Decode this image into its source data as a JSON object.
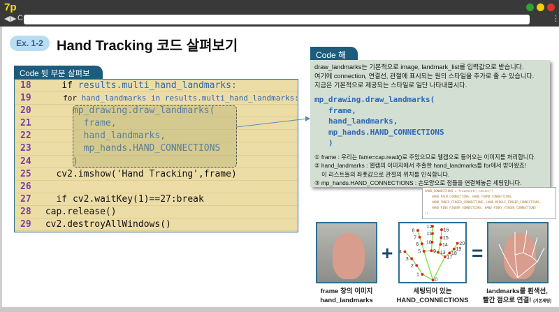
{
  "browser": {
    "logo": "7p",
    "back": "◀",
    "forward": "▶",
    "reload": "C",
    "menu": "⋮"
  },
  "header": {
    "badge": "Ex. 1-2",
    "title": "Hand Tracking 코드 살펴보기"
  },
  "code_section": {
    "tab": "Code 뒷 부분 살펴보기",
    "lines": [
      {
        "n": "18",
        "indent": "    ",
        "kw": "if ",
        "rest": "results.multi_hand_landmarks:"
      },
      {
        "n": "19",
        "indent": "     ",
        "kw": "for ",
        "rest": "hand_landmarks in results.multi_hand_landmarks:"
      },
      {
        "n": "20",
        "indent": "      ",
        "kw": "",
        "rest": "mp_drawing.draw_landmarks("
      },
      {
        "n": "21",
        "indent": "        ",
        "kw": "",
        "rest": "frame,"
      },
      {
        "n": "22",
        "indent": "        ",
        "kw": "",
        "rest": "hand_landmarks,"
      },
      {
        "n": "23",
        "indent": "        ",
        "kw": "",
        "rest": "mp_hands.HAND_CONNECTIONS"
      },
      {
        "n": "24",
        "indent": "      ",
        "kw": "",
        "rest": ")"
      },
      {
        "n": "25",
        "indent": "   ",
        "kw": "cv2.imshow('Hand Tracking',frame)",
        "rest": ""
      },
      {
        "n": "26",
        "indent": "",
        "kw": "",
        "rest": ""
      },
      {
        "n": "27",
        "indent": "   ",
        "kw": "if cv2.waitKey(1)==27:break",
        "rest": ""
      },
      {
        "n": "28",
        "indent": " ",
        "kw": "cap.release()",
        "rest": ""
      },
      {
        "n": "29",
        "indent": " ",
        "kw": "cv2.destroyAllWindows()",
        "rest": ""
      }
    ]
  },
  "explain": {
    "tab": "Code 해석",
    "intro": [
      "draw_landmarks는 기본적으로 image, landmark_list를 입력값으로 받습니다.",
      "여기에 connection, 연결선, 관절에 표시되는 원의 스타일을 추가로 줄 수 있습니다.",
      "지금은 기본적으로 제공되는 스타일로 일단 나타내봅시다."
    ],
    "code": [
      "mp_drawing.draw_landmarks(",
      "frame,",
      "hand_landmarks,",
      "mp_hands.HAND_CONNECTIONS",
      ")"
    ],
    "notes": [
      "① frame : 우리는 fame=cap.read()로 주었으므로 웹캠으로 들어오는 이미지를 처리합니다.",
      "② hand_landmarks : 웹캠의 이미지에서 추출한 hand_landmarks를 for에서 받아왔죠!",
      "이 리스트들의 좌푯값으로 관절의 위치를 인식합니다.",
      "③ mp_hands.HAND_CONNECTIONS : 손모양으로 점들을 연결해놓은 세팅입니다."
    ]
  },
  "snippet": "HAND_CONNECTIONS = frozenset().union(*[\n    HAND_PALM_CONNECTIONS, HAND_THUMB_CONNECTIONS,\n    HAND_INDEX_FINGER_CONNECTIONS, HAND_MIDDLE_FINGER_CONNECTIONS,\n    HAND_RING_FINGER_CONNECTIONS, HAND_PINKY_FINGER_CONNECTIONS\n])",
  "figure": {
    "plus": "+",
    "equals": "=",
    "captions": [
      [
        "frame 창의 이미지",
        "hand_landmarks"
      ],
      [
        "세팅되어 있는",
        "HAND_CONNECTIONS"
      ],
      [
        "landmarks를 흰색선,",
        "빨간 점으로 연결!",
        "(기본세팅)"
      ]
    ],
    "landmark_labels": [
      "0",
      "1",
      "2",
      "3",
      "4",
      "5",
      "6",
      "7",
      "8",
      "9",
      "10",
      "11",
      "12",
      "13",
      "14",
      "15",
      "16",
      "17",
      "18",
      "19",
      "20"
    ]
  },
  "colors": {
    "chrome": "#393939",
    "code_bg": "#ecdca6",
    "panel_bg": "#d3dfd3",
    "tab": "#1d5c7d",
    "accent_blue": "#2f67b3",
    "line_number": "#7a3fa0"
  }
}
